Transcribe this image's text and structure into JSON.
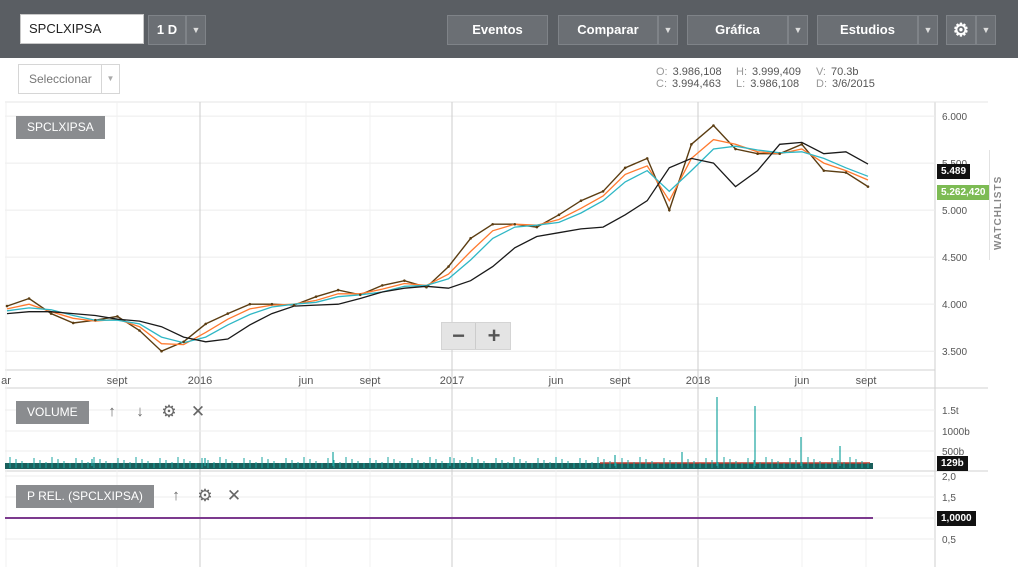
{
  "toolbar": {
    "symbol": "SPCLXIPSA",
    "interval": "1 D",
    "buttons": [
      "Eventos",
      "Comparar",
      "Gráfica",
      "Estudios"
    ]
  },
  "subbar": {
    "selector": "Seleccionar",
    "ohlc": {
      "o_key": "O:",
      "o": "3.986,108",
      "h_key": "H:",
      "h": "3.999,409",
      "v_key": "V:",
      "v": "70.3b",
      "c_key": "C:",
      "c": "3.994,463",
      "l_key": "L:",
      "l": "3.986,108",
      "d_key": "D:",
      "d": "3/6/2015"
    }
  },
  "colors": {
    "price": "#5b3d12",
    "ma_fast": "#ff7a2f",
    "ma_mid": "#2fb7c5",
    "ma_slow": "#1a1a1a",
    "volume": "#1aa5a0",
    "rel": "#7c3a8e"
  },
  "main_panel": {
    "label": "SPCLXIPSA",
    "y_ticks": [
      "6.000",
      "5.500",
      "5.000",
      "4.500",
      "4.000",
      "3.500"
    ],
    "x_ticks": [
      "ar",
      "sept",
      "2016",
      "jun",
      "sept",
      "2017",
      "jun",
      "sept",
      "2018",
      "jun",
      "sept"
    ],
    "tag_slow": "5.489",
    "tag_price": "5.262,420"
  },
  "volume_panel": {
    "label": "VOLUME",
    "y_ticks": [
      "1.5t",
      "1000b",
      "500b"
    ],
    "tag": "129b"
  },
  "rel_panel": {
    "label": "P REL. (SPCLXIPSA)",
    "y_ticks": [
      "2,0",
      "1,5",
      "1,0",
      "0,5"
    ],
    "tag": "1,0000"
  },
  "sidebar": {
    "watchlists": "WATCHLISTS"
  },
  "chart_data": {
    "type": "line",
    "x": [
      "2015-06",
      "2015-07",
      "2015-08",
      "2015-09",
      "2015-10",
      "2015-11",
      "2015-12",
      "2016-01",
      "2016-02",
      "2016-03",
      "2016-04",
      "2016-05",
      "2016-06",
      "2016-07",
      "2016-08",
      "2016-09",
      "2016-10",
      "2016-11",
      "2016-12",
      "2017-01",
      "2017-02",
      "2017-03",
      "2017-04",
      "2017-05",
      "2017-06",
      "2017-07",
      "2017-08",
      "2017-09",
      "2017-10",
      "2017-11",
      "2017-12",
      "2018-01",
      "2018-02",
      "2018-03",
      "2018-04",
      "2018-05",
      "2018-06",
      "2018-07",
      "2018-08",
      "2018-09"
    ],
    "series": [
      {
        "values": [
          3980,
          4060,
          3900,
          3800,
          3830,
          3870,
          3720,
          3500,
          3600,
          3790,
          3900,
          4000,
          4000,
          3990,
          4080,
          4150,
          4100,
          4200,
          4250,
          4180,
          4400,
          4700,
          4850,
          4850,
          4820,
          4950,
          5100,
          5200,
          5450,
          5550,
          5000,
          5700,
          5900,
          5650,
          5600,
          5600,
          5700,
          5420,
          5400,
          5250
        ]
      },
      {
        "values": [
          3950,
          4000,
          3920,
          3850,
          3820,
          3840,
          3760,
          3580,
          3570,
          3700,
          3840,
          3950,
          3990,
          4000,
          4040,
          4110,
          4110,
          4160,
          4220,
          4200,
          4320,
          4560,
          4780,
          4850,
          4840,
          4900,
          5020,
          5150,
          5380,
          5470,
          5100,
          5550,
          5750,
          5700,
          5620,
          5600,
          5650,
          5500,
          5420,
          5320
        ]
      },
      {
        "values": [
          3930,
          3960,
          3940,
          3880,
          3830,
          3830,
          3790,
          3650,
          3590,
          3650,
          3780,
          3890,
          3970,
          4000,
          4020,
          4080,
          4100,
          4130,
          4190,
          4200,
          4270,
          4470,
          4700,
          4820,
          4840,
          4870,
          4970,
          5100,
          5300,
          5420,
          5200,
          5420,
          5650,
          5680,
          5640,
          5610,
          5620,
          5550,
          5450,
          5360
        ]
      },
      {
        "values": [
          3900,
          3920,
          3920,
          3900,
          3880,
          3840,
          3820,
          3760,
          3650,
          3600,
          3630,
          3780,
          3900,
          3980,
          3990,
          4000,
          4060,
          4130,
          4170,
          4190,
          4170,
          4250,
          4400,
          4600,
          4720,
          4760,
          4800,
          4820,
          4950,
          5100,
          5450,
          5550,
          5500,
          5250,
          5420,
          5700,
          5720,
          5600,
          5620,
          5490
        ]
      }
    ],
    "ylim": [
      3300,
      6150
    ],
    "grid": true
  }
}
